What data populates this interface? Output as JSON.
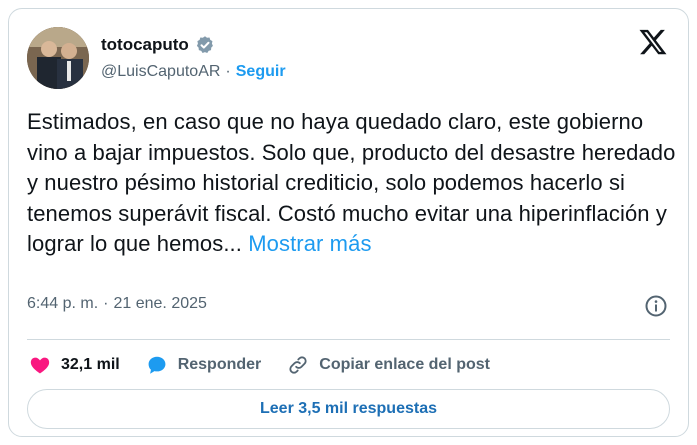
{
  "author": {
    "name": "totocaputo",
    "handle": "@LuisCaputoAR",
    "separator": "·",
    "follow_label": "Seguir"
  },
  "tweet": {
    "text": "Estimados, en caso que no haya quedado claro, este gobierno vino a bajar impuestos. Solo que, producto del desastre heredado y nuestro pésimo historial crediticio, solo podemos hacerlo si tenemos superávit fiscal. Costó mucho evitar una hiperinflación y lograr lo que hemos...",
    "show_more_label": "Mostrar más"
  },
  "meta": {
    "time": "6:44 p. m.",
    "separator": "·",
    "date": "21 ene. 2025"
  },
  "actions": {
    "likes": "32,1 mil",
    "reply_label": "Responder",
    "copy_label": "Copiar enlace del post"
  },
  "read_replies_label": "Leer 3,5 mil respuestas",
  "colors": {
    "accent": "#1d9bf0",
    "like": "#f91880",
    "muted": "#536471",
    "border": "#cfd9de"
  },
  "icons": [
    "verified-badge-icon",
    "x-logo-icon",
    "info-icon",
    "heart-icon",
    "reply-bubble-icon",
    "link-icon"
  ]
}
